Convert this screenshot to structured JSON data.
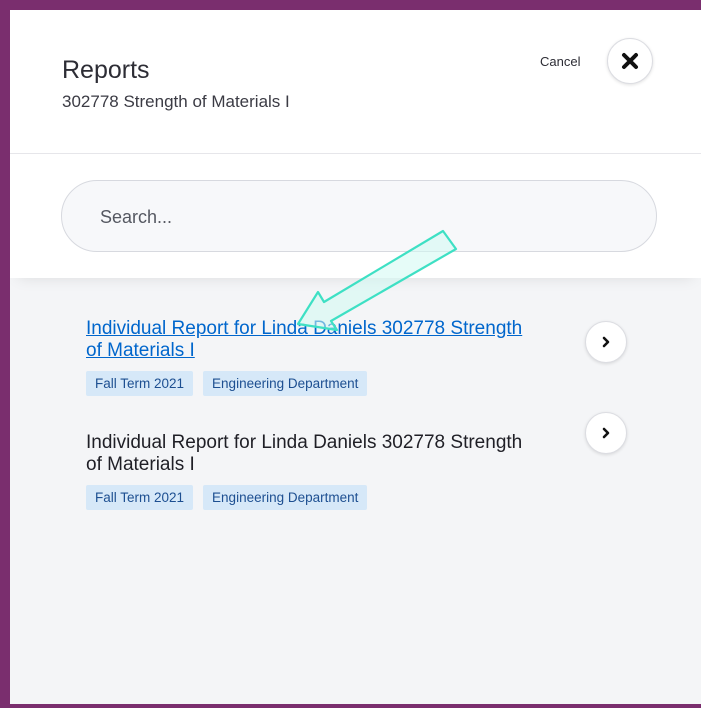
{
  "header": {
    "title": "Reports",
    "subtitle": "302778 Strength of Materials I",
    "cancel_label": "Cancel",
    "close_icon": "close-icon"
  },
  "search": {
    "placeholder": "Search..."
  },
  "results": [
    {
      "title": "Individual Report for Linda Daniels 302778 Strength of Materials I",
      "is_link": true,
      "tags": [
        "Fall Term 2021",
        "Engineering Department"
      ],
      "action_icon": "chevron-right-icon"
    },
    {
      "title": "Individual Report for Linda Daniels 302778 Strength of Materials I",
      "is_link": false,
      "tags": [
        "Fall Term 2021",
        "Engineering Department"
      ],
      "action_icon": "chevron-right-icon"
    }
  ],
  "annotation": {
    "type": "arrow",
    "color": "#3ee0c4",
    "icon": "annotation-arrow-icon"
  },
  "colors": {
    "frame": "#7a2e6e",
    "link": "#0066cc",
    "tag_bg": "#d6e8f8",
    "tag_text": "#1d4f91"
  }
}
